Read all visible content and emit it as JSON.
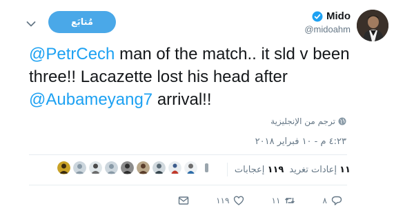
{
  "tweet": {
    "author_name": "Mido",
    "author_handle": "@midoahm",
    "follow_label": "مُتابَع",
    "text_mention_1": "@PetrCech",
    "text_part_1": " man of the match.. it sld v been three!! Lacazette lost his head after ",
    "text_mention_2": "@Aubameyang7",
    "text_part_2": " arrival!!",
    "translate_label": "ترجم من الإنجليزية",
    "timestamp": "٤:٢٣ م - ١٠ فبراير ٢٠١٨",
    "retweets_count": "١١",
    "retweets_label": "إعادات تغريد",
    "likes_count": "١١٩",
    "likes_label": "إعجابات"
  },
  "actions": {
    "reply_count": "٨",
    "retweet_count": "١١",
    "like_count": "١١٩"
  },
  "icons": {
    "verified": "verified-badge-icon",
    "chevron": "chevron-down-icon",
    "globe": "globe-icon",
    "reply": "reply-icon",
    "retweet": "retweet-icon",
    "like": "heart-icon",
    "message": "envelope-icon"
  },
  "colors": {
    "accent": "#1da1f2",
    "follow_button": "#4aa8e8",
    "muted_text": "#657786"
  }
}
